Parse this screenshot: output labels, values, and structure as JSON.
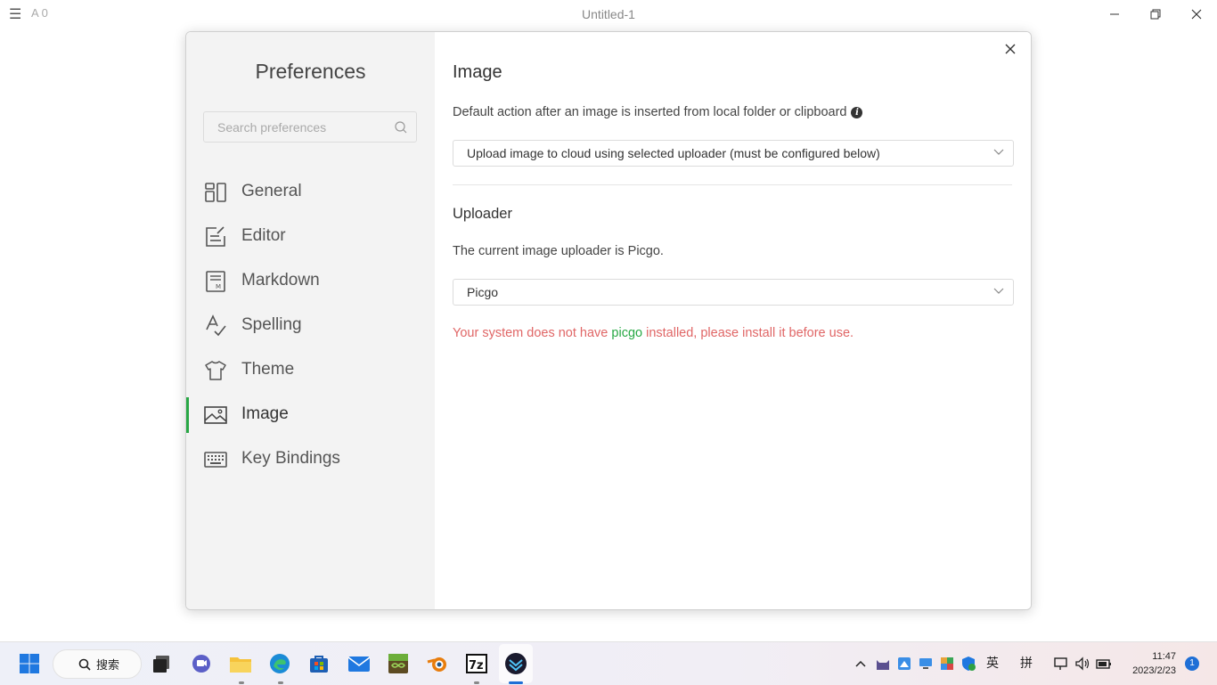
{
  "titlebar": {
    "menu_glyph": "☰",
    "word_count": "A 0",
    "title": "Untitled-1"
  },
  "sidebar": {
    "title": "Preferences",
    "search_placeholder": "Search preferences",
    "items": [
      {
        "label": "General",
        "icon": "general-icon"
      },
      {
        "label": "Editor",
        "icon": "editor-icon"
      },
      {
        "label": "Markdown",
        "icon": "markdown-icon"
      },
      {
        "label": "Spelling",
        "icon": "spelling-icon"
      },
      {
        "label": "Theme",
        "icon": "theme-icon"
      },
      {
        "label": "Image",
        "icon": "image-icon",
        "active": true
      },
      {
        "label": "Key Bindings",
        "icon": "keyboard-icon"
      }
    ]
  },
  "content": {
    "title": "Image",
    "default_action_desc": "Default action after an image is inserted from local folder or clipboard",
    "default_action_value": "Upload image to cloud using selected uploader (must be configured below)",
    "uploader_title": "Uploader",
    "uploader_desc": "The current image uploader is Picgo.",
    "uploader_value": "Picgo",
    "warning_pre": "Your system does not have ",
    "warning_link": "picgo",
    "warning_post": " installed, please install it before use."
  },
  "taskbar": {
    "search_label": "搜索",
    "ime_lang": "英",
    "ime_mode": "拼",
    "time": "11:47",
    "date": "2023/2/23",
    "notification_count": "1",
    "apps": [
      "start-icon",
      "task-view-icon",
      "teams-chat-icon",
      "file-explorer-icon",
      "edge-icon",
      "store-icon",
      "mail-icon",
      "minecraft-icon",
      "blender-icon",
      "7zip-icon",
      "marktext-icon"
    ]
  },
  "colors": {
    "accent": "#28a745",
    "warning": "#e06666",
    "sidebar_bg": "#f3f3f3"
  }
}
